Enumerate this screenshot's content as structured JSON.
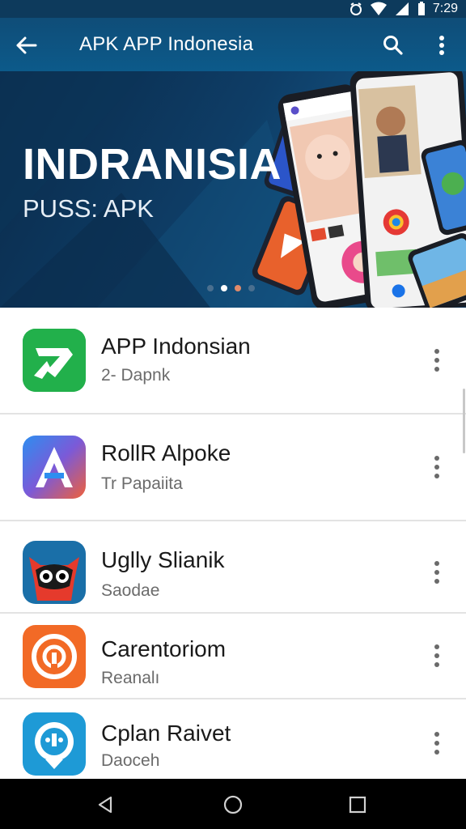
{
  "status_bar": {
    "time": "7:29"
  },
  "app_bar": {
    "title": "APK APP Indonesia",
    "back_icon": "arrow-left-icon",
    "search_icon": "search-icon",
    "overflow_icon": "more-vert-icon"
  },
  "banner": {
    "title": "INDRANISIA",
    "subtitle": "PUSS: APK",
    "page_count": 4,
    "active_page": 1
  },
  "apps": [
    {
      "name": "APP Indonsian",
      "subtitle": "2- Dapnk",
      "icon": "green-arrow-app-icon"
    },
    {
      "name": "RollR Alpoke",
      "subtitle": "Tr Papaiita",
      "icon": "letter-a-app-icon"
    },
    {
      "name": "Uglly Slianik",
      "subtitle": "Saodae",
      "icon": "masked-face-app-icon"
    },
    {
      "name": "Carentoriom",
      "subtitle": "Reanalı",
      "icon": "orange-sync-app-icon"
    },
    {
      "name": "Cplan Raivet",
      "subtitle": "Daoceh",
      "icon": "blue-badge-app-icon"
    }
  ],
  "colors": {
    "app_bar": "#0c5a8a",
    "status_bar": "#0d3a5c",
    "banner": "#0e3d66"
  },
  "nav_bar": {
    "back": "triangle-back-icon",
    "home": "circle-home-icon",
    "recents": "square-recents-icon"
  }
}
